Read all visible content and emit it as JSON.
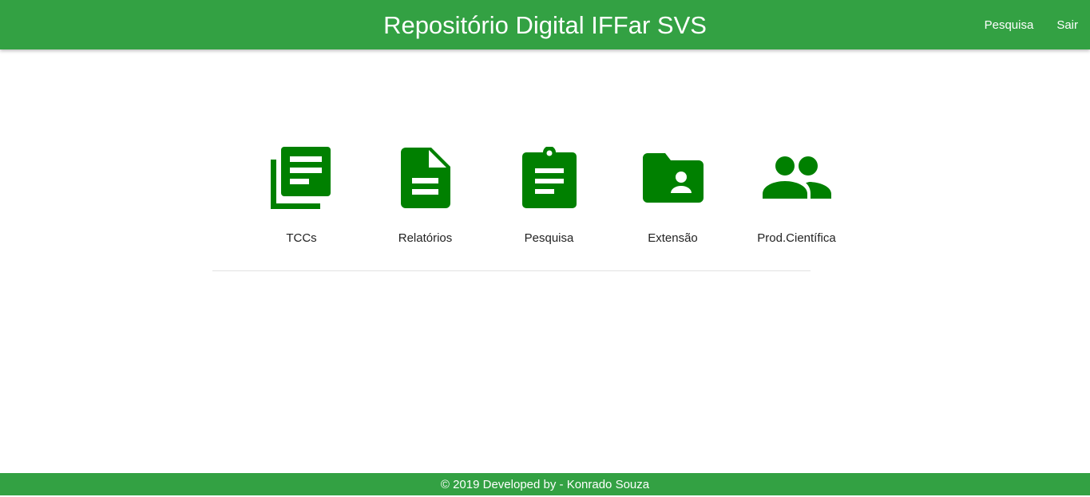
{
  "header": {
    "title": "Repositório Digital IFFar SVS",
    "links": [
      "Pesquisa",
      "Sair"
    ]
  },
  "categories": [
    {
      "label": "TCCs",
      "icon": "library-books-icon"
    },
    {
      "label": "Relatórios",
      "icon": "description-icon"
    },
    {
      "label": "Pesquisa",
      "icon": "assignment-icon"
    },
    {
      "label": "Extensão",
      "icon": "folder-shared-icon"
    },
    {
      "label": "Prod.Científica",
      "icon": "people-icon"
    }
  ],
  "footer": {
    "text": "© 2019 Developed by - Konrado Souza"
  },
  "colors": {
    "primary": "#33a143",
    "icon": "#008000"
  }
}
